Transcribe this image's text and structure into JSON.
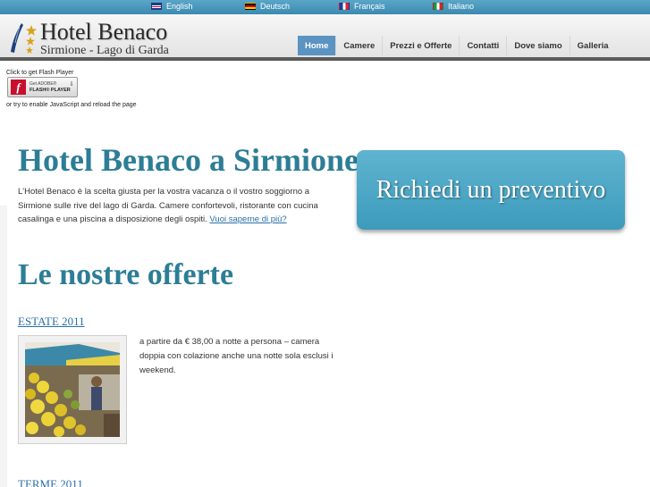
{
  "languages": [
    {
      "label": "English",
      "flag": "uk-flag-icon"
    },
    {
      "label": "Deutsch",
      "flag": "germany-flag-icon"
    },
    {
      "label": "Français",
      "flag": "france-flag-icon"
    },
    {
      "label": "Italiano",
      "flag": "italy-flag-icon"
    }
  ],
  "logo": {
    "title": "Hotel Benaco",
    "subtitle": "Sirmione - Lago di Garda"
  },
  "nav": [
    {
      "label": "Home",
      "active": true
    },
    {
      "label": "Camere"
    },
    {
      "label": "Prezzi e Offerte"
    },
    {
      "label": "Contatti"
    },
    {
      "label": "Dove siamo"
    },
    {
      "label": "Galleria"
    }
  ],
  "flash": {
    "prompt": "Click to get Flash Player",
    "badge_top": "Get ADOBE®",
    "badge_bottom": "FLASH® PLAYER",
    "js_note": "or try to enable JavaScript and reload the page"
  },
  "main": {
    "title": "Hotel Benaco a Sirmione",
    "intro": "L'Hotel Benaco è la scelta giusta per la vostra vacanza o il vostro soggiorno a Sirmione sulle rive del lago di Garda. Camere confortevoli, ristorante con cucina casalinga e una piscina a disposizione degli ospiti.",
    "more_link": "Vuoi saperne di più?"
  },
  "cta": {
    "label": "Richiedi un preventivo"
  },
  "offers": {
    "title": "Le nostre offerte",
    "items": [
      {
        "name": "ESTATE 2011",
        "text": "a partire da € 38,00 a notte a persona – camera doppia con colazione anche una notte sola esclusi i weekend."
      },
      {
        "name": "TERME 2011"
      }
    ]
  },
  "colors": {
    "accent": "#2d7d96",
    "nav_active": "#5b93c2",
    "cta": "#3d9bbc"
  }
}
